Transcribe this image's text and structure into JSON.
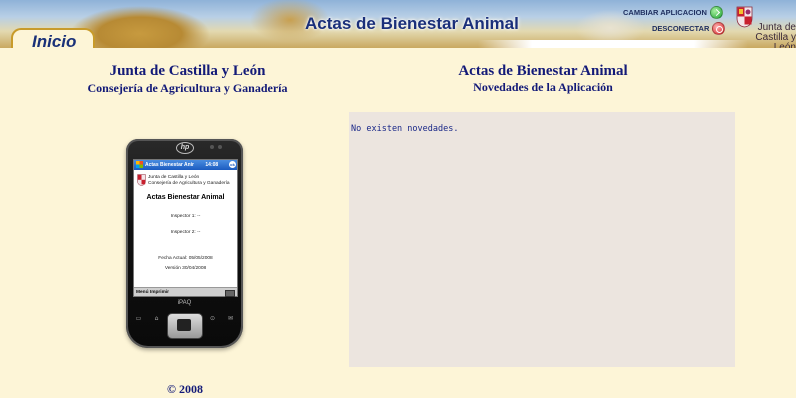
{
  "header": {
    "title": "Actas de Bienestar Animal",
    "tab_home": "Inicio",
    "change_app": "CAMBIAR APLICACION",
    "disconnect": "DESCONECTAR",
    "logo_text_1": "Junta de",
    "logo_text_2": "Castilla y León"
  },
  "left": {
    "org_title": "Junta de Castilla y León",
    "org_subtitle": "Consejería de Agricultura y Ganadería",
    "copyright": "© 2008"
  },
  "device": {
    "app_bar": "Actas Bienestar Anir",
    "app_bar_status": "14:08",
    "org_line1": "Junta de Castilla y León",
    "org_line2": "Consejería de Agricultura y Ganadería",
    "heading": "Actas Bienestar Animal",
    "inspector1": "Inspector 1: --",
    "inspector2": "Inspector 2: --",
    "date": "Fecha Actual: 05/05/2008",
    "version": "Versión 30/04/2008",
    "menu": "Menú  Imprimir",
    "brand": "iPAQ"
  },
  "right": {
    "app_title": "Actas de Bienestar Animal",
    "app_subtitle": "Novedades de la Aplicación",
    "news_text": "No existen novedades."
  },
  "colors": {
    "page_bg": "#fdf5d7",
    "heading": "#131a78",
    "panel_bg": "#ece5df",
    "tab_border": "#c89b2a"
  },
  "icons": {
    "change_app": "green-check-circle-icon",
    "disconnect": "red-power-circle-icon",
    "logo": "castilla-leon-shield-icon"
  }
}
